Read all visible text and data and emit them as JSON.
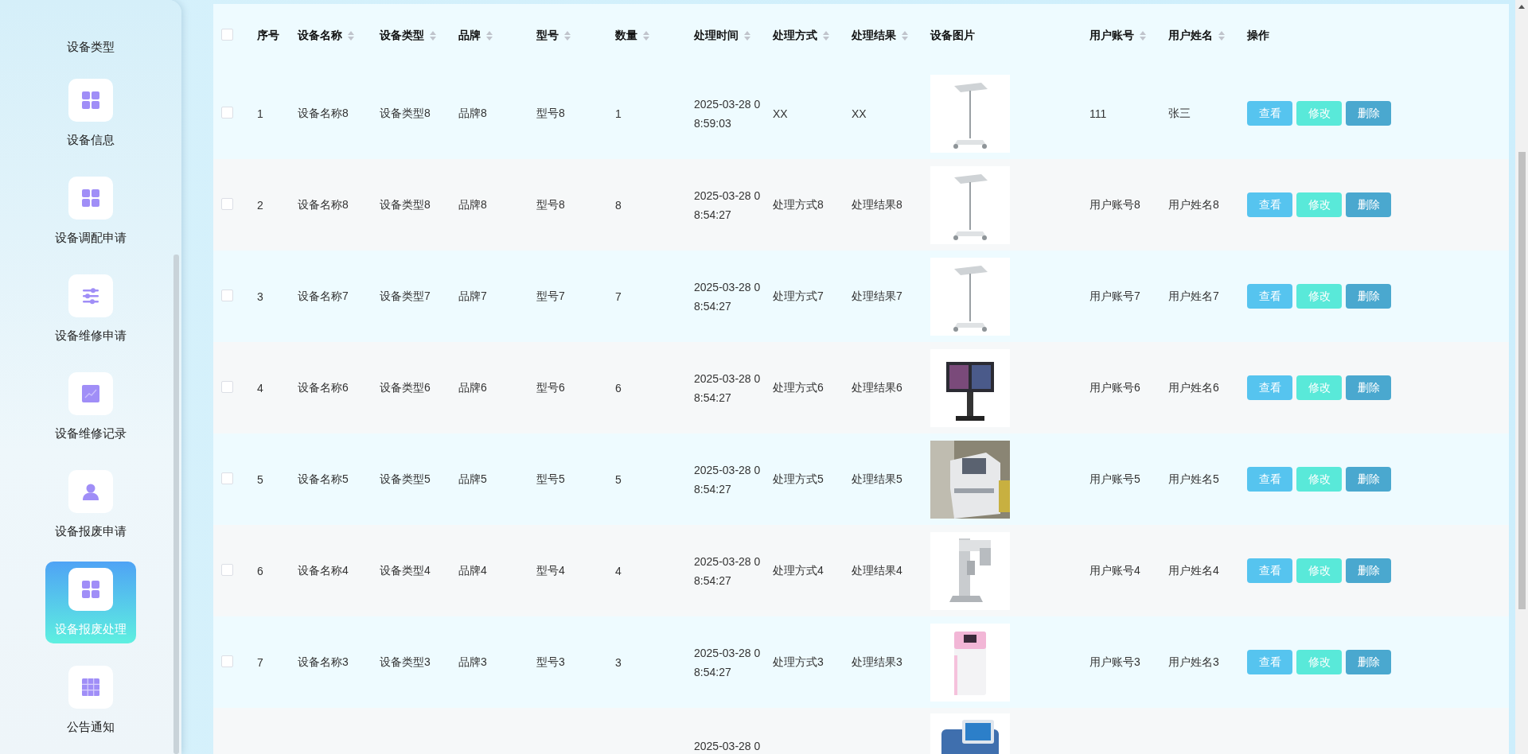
{
  "sidebar": {
    "items": [
      {
        "label": "设备类型",
        "selected": false
      },
      {
        "label": "设备信息",
        "selected": false
      },
      {
        "label": "设备调配申请",
        "selected": false
      },
      {
        "label": "设备维修申请",
        "selected": false
      },
      {
        "label": "设备维修记录",
        "selected": false
      },
      {
        "label": "设备报废申请",
        "selected": false
      },
      {
        "label": "设备报废处理",
        "selected": true
      },
      {
        "label": "公告通知",
        "selected": false
      }
    ]
  },
  "table": {
    "select_all": {
      "checked": false
    },
    "columns": [
      {
        "label": "序号",
        "sortable": false
      },
      {
        "label": "设备名称",
        "sortable": true
      },
      {
        "label": "设备类型",
        "sortable": true
      },
      {
        "label": "品牌",
        "sortable": true
      },
      {
        "label": "型号",
        "sortable": true
      },
      {
        "label": "数量",
        "sortable": true
      },
      {
        "label": "处理时间",
        "sortable": true
      },
      {
        "label": "处理方式",
        "sortable": true
      },
      {
        "label": "处理结果",
        "sortable": true
      },
      {
        "label": "设备图片",
        "sortable": false
      },
      {
        "label": "用户账号",
        "sortable": true
      },
      {
        "label": "用户姓名",
        "sortable": true
      },
      {
        "label": "操作",
        "sortable": false
      }
    ],
    "rows": [
      {
        "checked": false,
        "cells": [
          "1",
          "设备名称8",
          "设备类型8",
          "品牌8",
          "型号8",
          "1",
          "2025-03-28 08:59:03",
          "XX",
          "XX",
          null,
          "111",
          "张三"
        ],
        "actions": [
          "查看",
          "修改",
          "删除"
        ]
      },
      {
        "checked": false,
        "cells": [
          "2",
          "设备名称8",
          "设备类型8",
          "品牌8",
          "型号8",
          "8",
          "2025-03-28 08:54:27",
          "处理方式8",
          "处理结果8",
          null,
          "用户账号8",
          "用户姓名8"
        ],
        "actions": [
          "查看",
          "修改",
          "删除"
        ]
      },
      {
        "checked": false,
        "cells": [
          "3",
          "设备名称7",
          "设备类型7",
          "品牌7",
          "型号7",
          "7",
          "2025-03-28 08:54:27",
          "处理方式7",
          "处理结果7",
          null,
          "用户账号7",
          "用户姓名7"
        ],
        "actions": [
          "查看",
          "修改",
          "删除"
        ]
      },
      {
        "checked": false,
        "cells": [
          "4",
          "设备名称6",
          "设备类型6",
          "品牌6",
          "型号6",
          "6",
          "2025-03-28 08:54:27",
          "处理方式6",
          "处理结果6",
          null,
          "用户账号6",
          "用户姓名6"
        ],
        "actions": [
          "查看",
          "修改",
          "删除"
        ]
      },
      {
        "checked": false,
        "cells": [
          "5",
          "设备名称5",
          "设备类型5",
          "品牌5",
          "型号5",
          "5",
          "2025-03-28 08:54:27",
          "处理方式5",
          "处理结果5",
          null,
          "用户账号5",
          "用户姓名5"
        ],
        "actions": [
          "查看",
          "修改",
          "删除"
        ]
      },
      {
        "checked": false,
        "cells": [
          "6",
          "设备名称4",
          "设备类型4",
          "品牌4",
          "型号4",
          "4",
          "2025-03-28 08:54:27",
          "处理方式4",
          "处理结果4",
          null,
          "用户账号4",
          "用户姓名4"
        ],
        "actions": [
          "查看",
          "修改",
          "删除"
        ]
      },
      {
        "checked": false,
        "cells": [
          "7",
          "设备名称3",
          "设备类型3",
          "品牌3",
          "型号3",
          "3",
          "2025-03-28 08:54:27",
          "处理方式3",
          "处理结果3",
          null,
          "用户账号3",
          "用户姓名3"
        ],
        "actions": [
          "查看",
          "修改",
          "删除"
        ]
      },
      {
        "cells": [
          null,
          null,
          null,
          null,
          null,
          null,
          "2025-03-28 0",
          null,
          null,
          null,
          null,
          null
        ]
      }
    ]
  }
}
